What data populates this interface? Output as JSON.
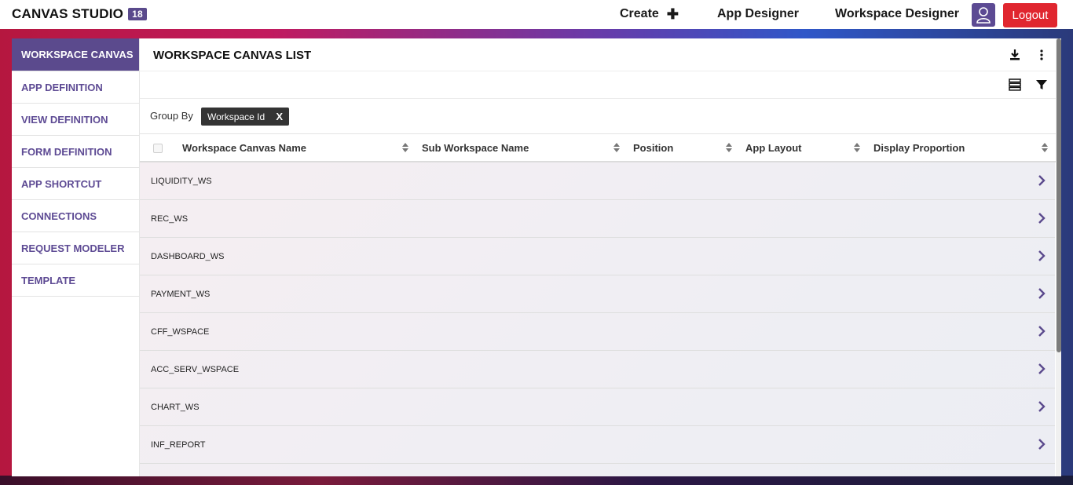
{
  "header": {
    "brand": "CANVAS STUDIO",
    "version": "18",
    "nav": {
      "create": "Create",
      "create_icon": "plus-icon",
      "app_designer": "App Designer",
      "workspace_designer": "Workspace Designer"
    },
    "user_icon": "user-icon",
    "logout": "Logout"
  },
  "sidebar": {
    "items": [
      {
        "label": "WORKSPACE CANVAS",
        "active": true
      },
      {
        "label": "APP DEFINITION"
      },
      {
        "label": "VIEW DEFINITION"
      },
      {
        "label": "FORM DEFINITION"
      },
      {
        "label": "APP SHORTCUT"
      },
      {
        "label": "CONNECTIONS"
      },
      {
        "label": "REQUEST MODELER"
      },
      {
        "label": "TEMPLATE"
      }
    ]
  },
  "main": {
    "title": "WORKSPACE CANVAS LIST",
    "header_icons": [
      "download-icon",
      "more-vertical-icon"
    ],
    "toolbar_icons": [
      "column-settings-icon",
      "filter-icon"
    ],
    "group_by": {
      "label": "Group By",
      "chip": "Workspace Id",
      "chip_close": "X"
    },
    "table": {
      "columns": [
        "Workspace Canvas Name",
        "Sub Workspace Name",
        "Position",
        "App Layout",
        "Display Proportion"
      ],
      "rows": [
        "LIQUIDITY_WS",
        "REC_WS",
        "DASHBOARD_WS",
        "PAYMENT_WS",
        "CFF_WSPACE",
        "ACC_SERV_WSPACE",
        "CHART_WS",
        "INF_REPORT"
      ]
    }
  },
  "colors": {
    "accent": "#5b4a8d",
    "logout": "#e0262f",
    "link": "#5e4b94"
  }
}
